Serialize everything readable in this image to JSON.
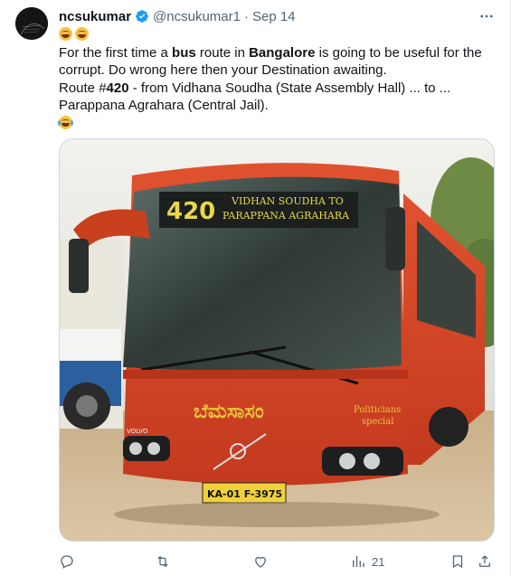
{
  "tweet": {
    "author_name": "ncsukumar",
    "handle": "@ncsukumar1",
    "separator": "·",
    "date": "Sep 14",
    "lines": {
      "l2_a": "For the first time a ",
      "l2_b": "bus",
      "l2_c": " route in ",
      "l2_d": "Bangalore",
      "l2_e": " is going to be useful for the corrupt.  Do wrong here then your Destination awaiting.",
      "l3_a": "Route #",
      "l3_b": "420",
      "l3_c": " - from Vidhana Soudha (State Assembly Hall) ... to ... Parappana Agrahara (Central Jail)."
    },
    "image": {
      "route_number": "420",
      "destination_line1": "VIDHAN SOUDHA TO",
      "destination_line2": "PARAPPANA AGRAHARA",
      "side_text_line1": "Politicians",
      "side_text_line2": "special",
      "kannada_text": "ಬೆಮಸಾಸಂ",
      "plate": "KA-01 F-3975",
      "brand": "VOLVO"
    },
    "actions": {
      "views_count": "21"
    }
  },
  "colors": {
    "accent": "#1d9bf0",
    "text": "#0f1419",
    "secondary": "#536471",
    "bus_red": "#d9482b"
  }
}
